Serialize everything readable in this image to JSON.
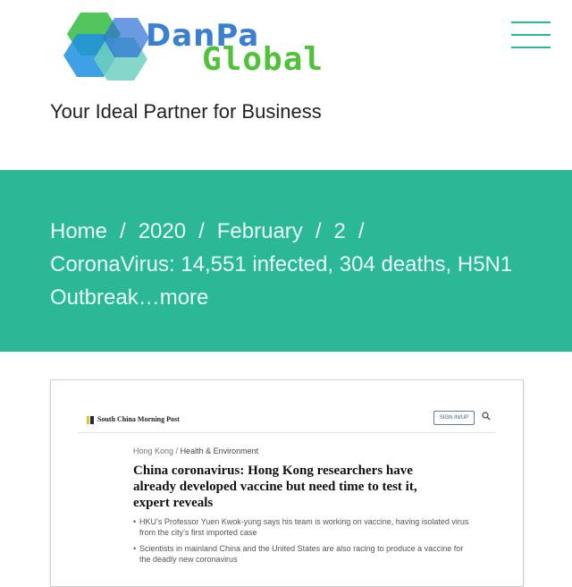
{
  "header": {
    "logo": {
      "line1": "DanPa",
      "line2": "Global"
    },
    "tagline": "Your Ideal Partner for Business",
    "menu_icon": "hamburger-menu-icon"
  },
  "breadcrumb": {
    "items": [
      "Home",
      "2020",
      "February",
      "2"
    ],
    "separator": "/",
    "current": "CoronaVirus: 14,551 infected, 304 deaths, H5N1 Outbreak…more"
  },
  "article_image": {
    "publisher": "South China Morning Post",
    "sign_in": "SIGN IN/UP",
    "section_parent": "Hong Kong /",
    "section": "Health & Environment",
    "headline": "China coronavirus: Hong Kong researchers have already developed vaccine but need time to test it, expert reveals",
    "bullets": [
      "HKU’s Professor Yuen Kwok-yung says his team is working on vaccine, having isolated virus from the city’s first imported case",
      "Scientists in mainland China and the United States are also racing to produce a vaccine for the deadly new coronavirus"
    ]
  },
  "colors": {
    "accent_teal": "#2ab896",
    "logo_blue": "#3a7fd1",
    "logo_green": "#4fc23a"
  }
}
